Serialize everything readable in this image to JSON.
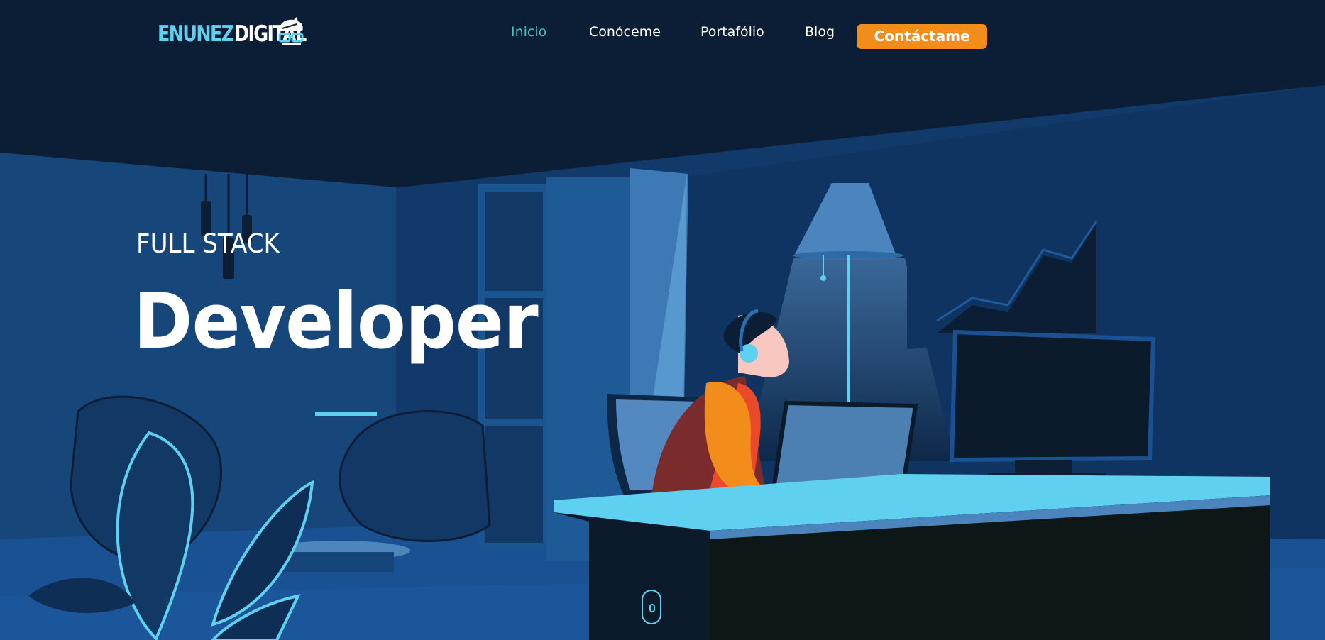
{
  "brand": {
    "part1": "ENUNEZ",
    "part2": "DIGITAL",
    "icon": "geek-face-with-glasses-icon"
  },
  "nav": {
    "items": [
      {
        "label": "Inicio",
        "active": true
      },
      {
        "label": "Conóceme",
        "active": false
      },
      {
        "label": "Portafólio",
        "active": false
      },
      {
        "label": "Blog",
        "active": false
      }
    ],
    "cta_label": "Contáctame"
  },
  "hero": {
    "subtitle": "FULL STACK",
    "title": "Developer",
    "scroll_icon": "mouse-scroll-icon"
  },
  "colors": {
    "background": "#0b1e36",
    "accent_cyan": "#5fd0f0",
    "accent_green": "#3fc7b3",
    "cta_orange": "#f28d1b"
  }
}
